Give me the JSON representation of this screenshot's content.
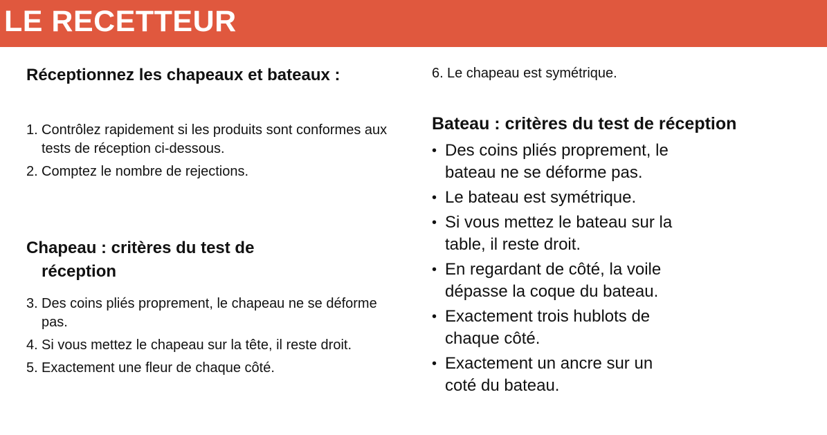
{
  "header": {
    "title": "LE RECETTEUR"
  },
  "left": {
    "reception_title": "Réceptionnez les chapeaux et bateaux :",
    "reception_items": [
      {
        "num": "1.",
        "text": "Contrôlez rapidement si les produits sont conformes aux tests de réception ci-dessous."
      },
      {
        "num": "2.",
        "text": "Comptez le nombre de rejections."
      }
    ],
    "hat_title_line1": "Chapeau : critères du test de",
    "hat_title_line2": "réception",
    "hat_items": [
      {
        "num": "3.",
        "text": "Des coins pliés proprement, le chapeau ne se déforme pas."
      },
      {
        "num": "4.",
        "text": "Si vous mettez le chapeau sur la tête, il reste droit."
      },
      {
        "num": "5.",
        "text": "Exactement une fleur de chaque côté."
      }
    ]
  },
  "right": {
    "hat_item_6": {
      "num": "6.",
      "text": "Le chapeau est symétrique."
    },
    "boat_title": "Bateau : critères du test de réception",
    "boat_items": [
      "Des coins pliés proprement, le bateau ne se déforme pas.",
      "Le bateau est symétrique.",
      "Si vous mettez le bateau sur la table, il reste droit.",
      "En regardant de côté, la voile dépasse la coque du bateau.",
      "Exactement trois hublots de chaque côté.",
      "Exactement un ancre sur un coté du bateau."
    ]
  },
  "colors": {
    "banner": "#E0583E",
    "text": "#111111",
    "banner_text": "#FFFFFF"
  }
}
